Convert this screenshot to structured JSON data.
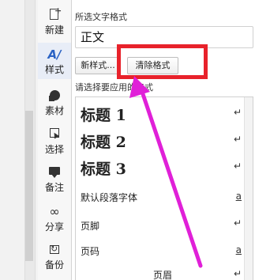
{
  "panel": {
    "current_section_label": "所选文字格式",
    "current_format_value": "正文",
    "new_style_button": "新样式...",
    "clear_format_button": "清除格式",
    "apply_section_label": "请选择要应用的格式"
  },
  "toolbar": [
    {
      "label": "新建",
      "icon": "new-doc-icon"
    },
    {
      "label": "样式",
      "icon": "style-icon"
    },
    {
      "label": "素材",
      "icon": "material-icon"
    },
    {
      "label": "选择",
      "icon": "select-icon"
    },
    {
      "label": "备注",
      "icon": "note-icon"
    },
    {
      "label": "分享",
      "icon": "share-icon"
    },
    {
      "label": "备份",
      "icon": "backup-icon"
    }
  ],
  "style_list": [
    {
      "name": "标题 1",
      "mark": "↵"
    },
    {
      "name": "标题 2",
      "mark": "↵"
    },
    {
      "name": "标题 3",
      "mark": "↵"
    },
    {
      "name": "默认段落字体",
      "mark": "a"
    },
    {
      "name": "页脚",
      "mark": "↵"
    },
    {
      "name": "页码",
      "mark": "a"
    },
    {
      "name": "页眉",
      "mark": "↵"
    }
  ],
  "colors": {
    "highlight": "#e8222b",
    "arrow": "#e020d8",
    "style_accent": "#2b63c4"
  }
}
